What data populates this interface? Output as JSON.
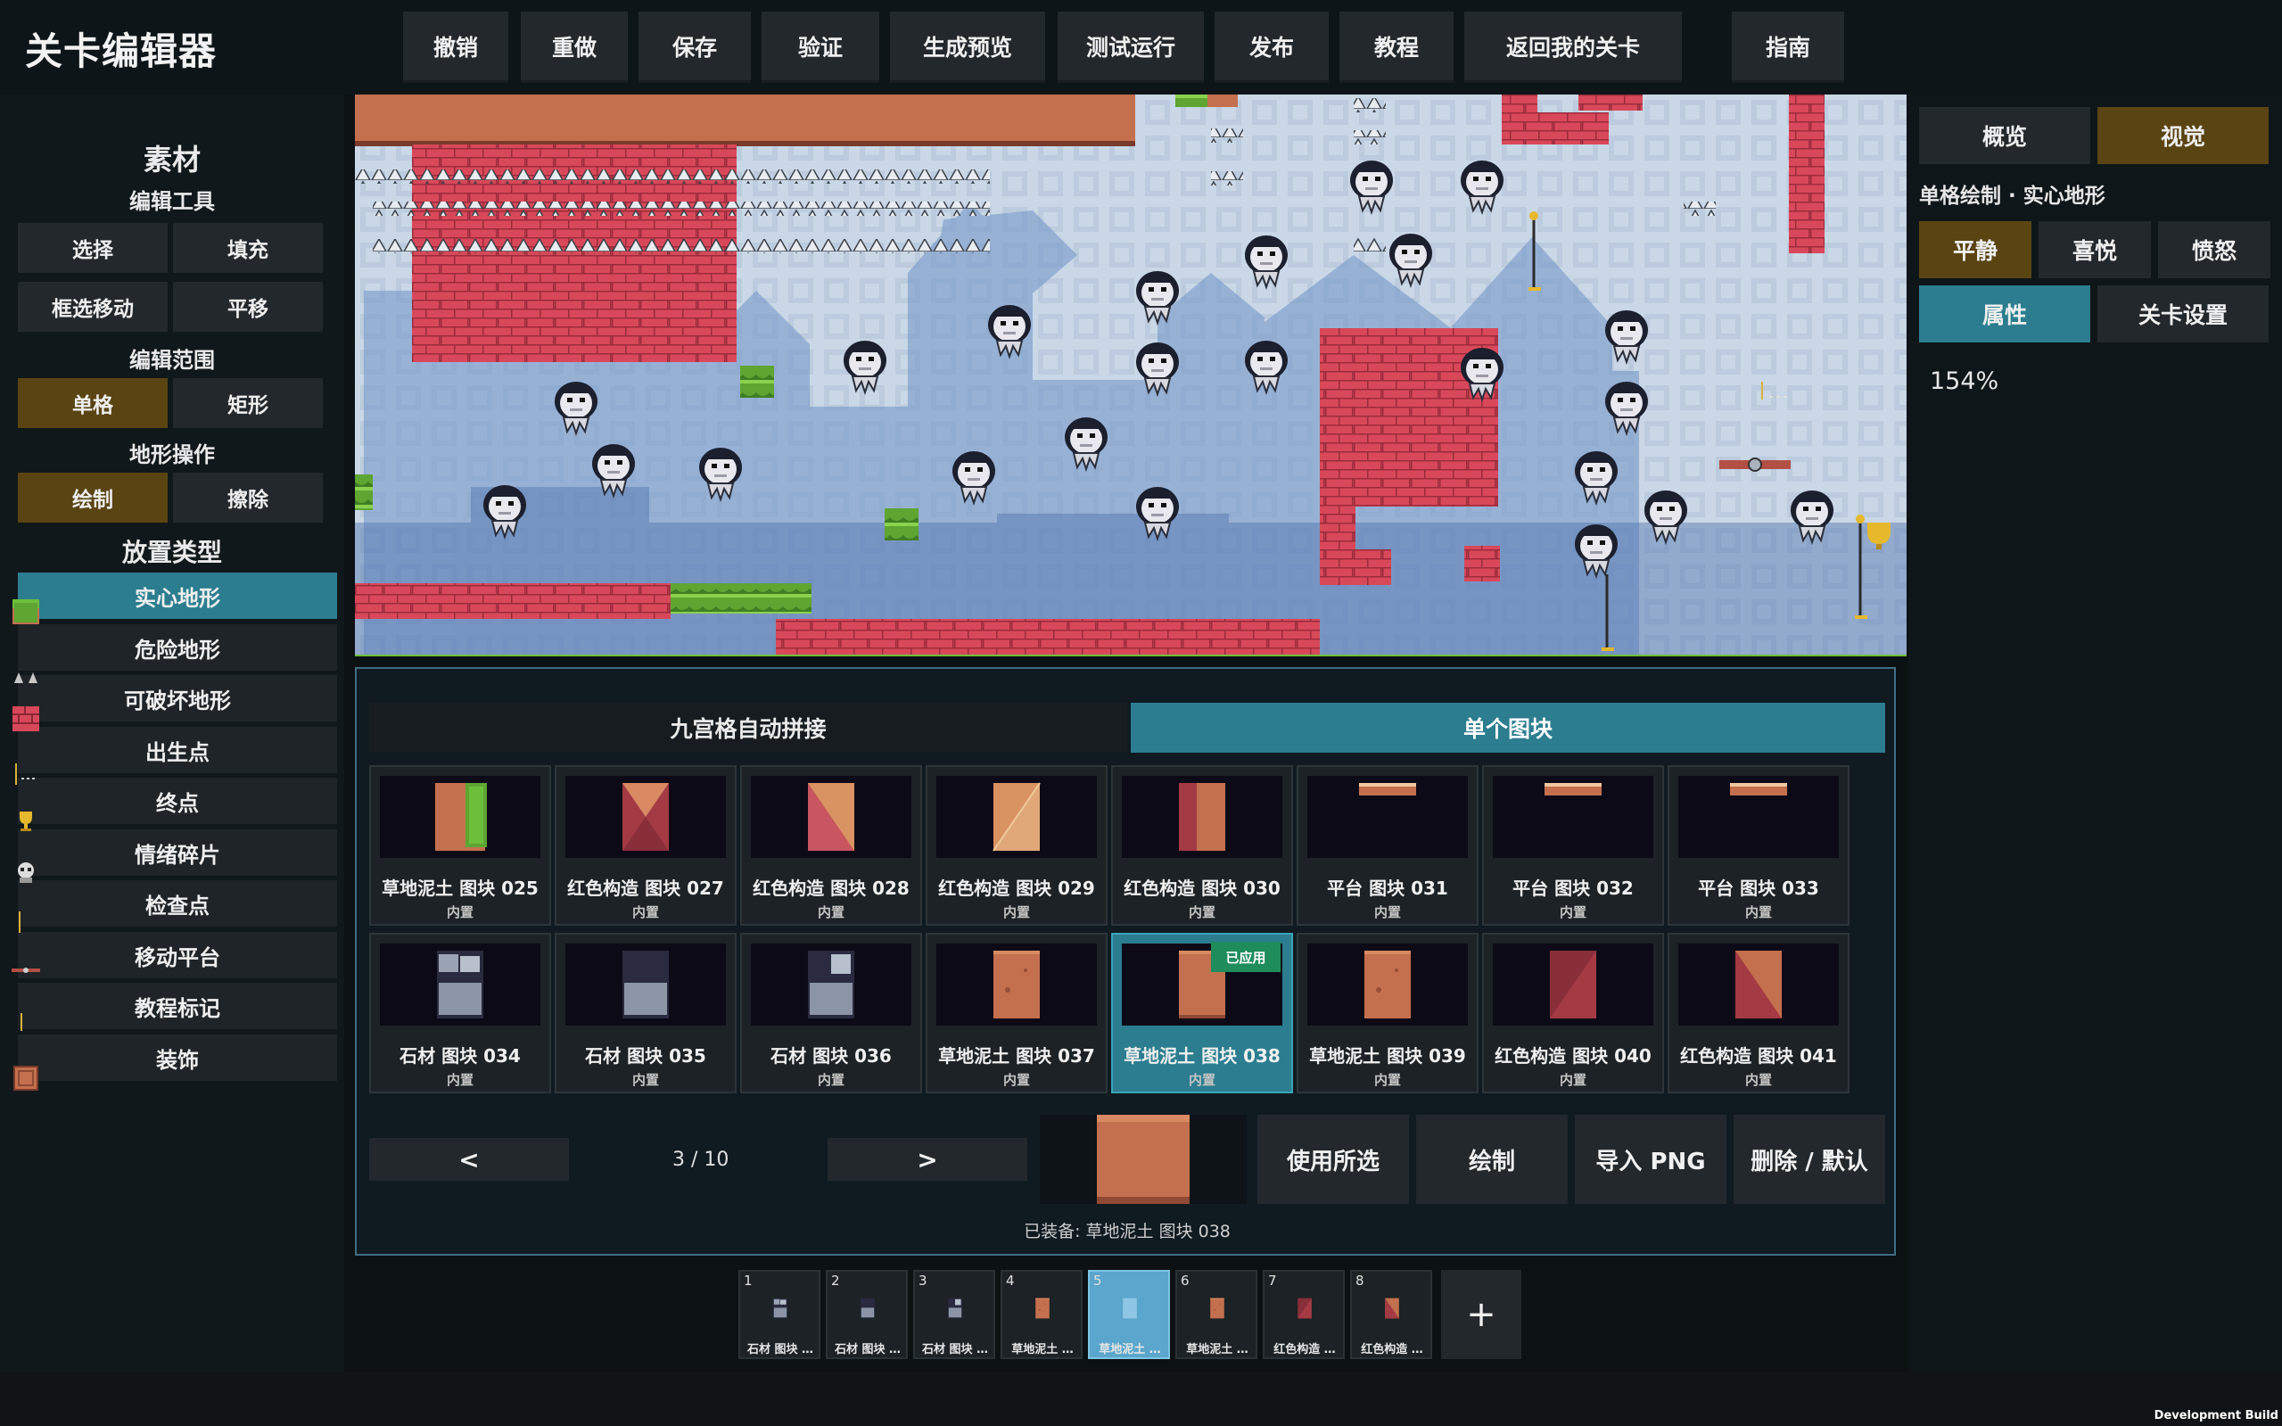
{
  "app": {
    "title": "关卡编辑器"
  },
  "toolbar": {
    "items": [
      "撤销",
      "重做",
      "保存",
      "验证",
      "生成预览",
      "测试运行",
      "发布",
      "教程",
      "返回我的关卡"
    ],
    "guide": "指南"
  },
  "left": {
    "title": "素材",
    "edit_tools": {
      "heading": "编辑工具",
      "buttons": [
        "选择",
        "填充",
        "框选移动",
        "平移"
      ]
    },
    "edit_range": {
      "heading": "编辑范围",
      "buttons": [
        "单格",
        "矩形"
      ],
      "selected": "单格"
    },
    "terrain_ops": {
      "heading": "地形操作",
      "buttons": [
        "绘制",
        "擦除"
      ],
      "selected": "绘制"
    },
    "placement": {
      "heading": "放置类型",
      "items": [
        "实心地形",
        "危险地形",
        "可破坏地形",
        "出生点",
        "终点",
        "情绪碎片",
        "检查点",
        "移动平台",
        "教程标记",
        "装饰"
      ],
      "selected": "实心地形"
    }
  },
  "right": {
    "tabs": [
      "概览",
      "视觉"
    ],
    "active_tab": "视觉",
    "mode_text": "单格绘制 · 实心地形",
    "moods": [
      "平静",
      "喜悦",
      "愤怒"
    ],
    "active_mood": "平静",
    "subtabs": [
      "属性",
      "关卡设置"
    ],
    "active_subtab": "属性",
    "zoom": "154%"
  },
  "panel": {
    "tabs": [
      "九宫格自动拼接",
      "单个图块"
    ],
    "active_tab": "单个图块",
    "tiles": [
      {
        "name": "草地泥土 图块 025",
        "source": "内置",
        "art": "grass-dirt-edge"
      },
      {
        "name": "红色构造 图块 027",
        "source": "内置",
        "art": "red-cross"
      },
      {
        "name": "红色构造 图块 028",
        "source": "内置",
        "art": "red-diag-a"
      },
      {
        "name": "红色构造 图块 029",
        "source": "内置",
        "art": "red-diag-b"
      },
      {
        "name": "红色构造 图块 030",
        "source": "内置",
        "art": "red-column"
      },
      {
        "name": "平台 图块 031",
        "source": "内置",
        "art": "platform"
      },
      {
        "name": "平台 图块 032",
        "source": "内置",
        "art": "platform"
      },
      {
        "name": "平台 图块 033",
        "source": "内置",
        "art": "platform"
      },
      {
        "name": "石材 图块 034",
        "source": "内置",
        "art": "stone-a"
      },
      {
        "name": "石材 图块 035",
        "source": "内置",
        "art": "stone-b"
      },
      {
        "name": "石材 图块 036",
        "source": "内置",
        "art": "stone-c"
      },
      {
        "name": "草地泥土 图块 037",
        "source": "内置",
        "art": "dirt"
      },
      {
        "name": "草地泥土 图块 038",
        "source": "内置",
        "art": "dirt-plain",
        "applied": true
      },
      {
        "name": "草地泥土 图块 039",
        "source": "内置",
        "art": "dirt"
      },
      {
        "name": "红色构造 图块 040",
        "source": "内置",
        "art": "red-diag-c"
      },
      {
        "name": "红色构造 图块 041",
        "source": "内置",
        "art": "red-diag-d"
      }
    ],
    "applied_badge": "已应用",
    "prev": "<",
    "next": ">",
    "page": "3 / 10",
    "actions": [
      "使用所选",
      "绘制",
      "导入 PNG",
      "删除 / 默认"
    ],
    "equipped": "已装备: 草地泥土 图块 038"
  },
  "hotbar": {
    "slots": [
      {
        "num": "1",
        "label": "石材 图块 …",
        "art": "stone-a"
      },
      {
        "num": "2",
        "label": "石材 图块 …",
        "art": "stone-b"
      },
      {
        "num": "3",
        "label": "石材 图块 …",
        "art": "stone-c"
      },
      {
        "num": "4",
        "label": "草地泥土 …",
        "art": "dirt"
      },
      {
        "num": "5",
        "label": "草地泥土 …",
        "art": "selected",
        "selected": true
      },
      {
        "num": "6",
        "label": "草地泥土 …",
        "art": "dirt"
      },
      {
        "num": "7",
        "label": "红色构造 …",
        "art": "red-diag-c"
      },
      {
        "num": "8",
        "label": "红色构造 …",
        "art": "red-diag-d"
      }
    ],
    "add": "+"
  },
  "footer": {
    "build": "Development Build"
  },
  "colors": {
    "accent_teal": "#2b7d8f",
    "accent_gold": "#5a4412",
    "brick": "#d9485a",
    "dirt": "#c4704e",
    "grass": "#6dbf3b"
  }
}
